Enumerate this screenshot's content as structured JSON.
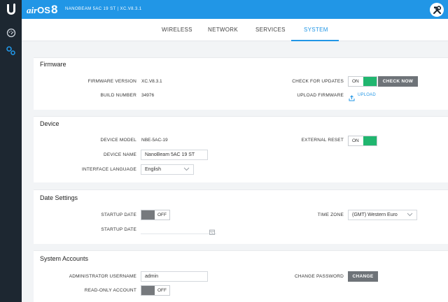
{
  "header": {
    "brand_air": "air",
    "brand_os": "OS",
    "brand_version": "8",
    "device_title": "NANOBEAM 5AC 19 ST | XC.V8.3.1"
  },
  "icons": {
    "logo": "ubiquiti-u-logo-icon",
    "tools": "tools-icon",
    "dashboard": "gauge-icon",
    "settings": "gears-icon",
    "upload": "upload-icon",
    "calendar": "calendar-icon",
    "chevron": "chevron-down-icon"
  },
  "colors": {
    "header_blue": "#2196e6",
    "sidebar_dark": "#1d2731",
    "toggle_green": "#20b66f",
    "button_gray": "#6e7378"
  },
  "tabs": [
    {
      "label": "WIRELESS"
    },
    {
      "label": "NETWORK"
    },
    {
      "label": "SERVICES"
    },
    {
      "label": "SYSTEM"
    }
  ],
  "active_tab": "SYSTEM",
  "firmware": {
    "title": "Firmware",
    "version_label": "FIRMWARE VERSION",
    "version_value": "XC.V8.3.1",
    "build_label": "BUILD NUMBER",
    "build_value": "34976",
    "check_updates_label": "CHECK FOR UPDATES",
    "check_updates_toggle": "ON",
    "check_now_button": "CHECK NOW",
    "upload_label": "UPLOAD FIRMWARE",
    "upload_link": "UPLOAD"
  },
  "device": {
    "title": "Device",
    "model_label": "DEVICE MODEL",
    "model_value": "NBE-5AC-19",
    "name_label": "DEVICE NAME",
    "name_value": "NanoBeam 5AC 19 ST",
    "language_label": "INTERFACE LANGUAGE",
    "language_value": "English",
    "reset_label": "EXTERNAL RESET",
    "reset_toggle": "ON"
  },
  "date_settings": {
    "title": "Date Settings",
    "startup_date_label": "STARTUP DATE",
    "startup_date_toggle": "OFF",
    "startup_date2_label": "STARTUP DATE",
    "startup_date2_value": "",
    "timezone_label": "TIME ZONE",
    "timezone_value": "(GMT) Western Euro"
  },
  "accounts": {
    "title": "System Accounts",
    "admin_label": "ADMINISTRATOR USERNAME",
    "admin_value": "admin",
    "readonly_label": "READ-ONLY ACCOUNT",
    "readonly_toggle": "OFF",
    "change_password_label": "CHANGE PASSWORD",
    "change_button": "CHANGE"
  }
}
